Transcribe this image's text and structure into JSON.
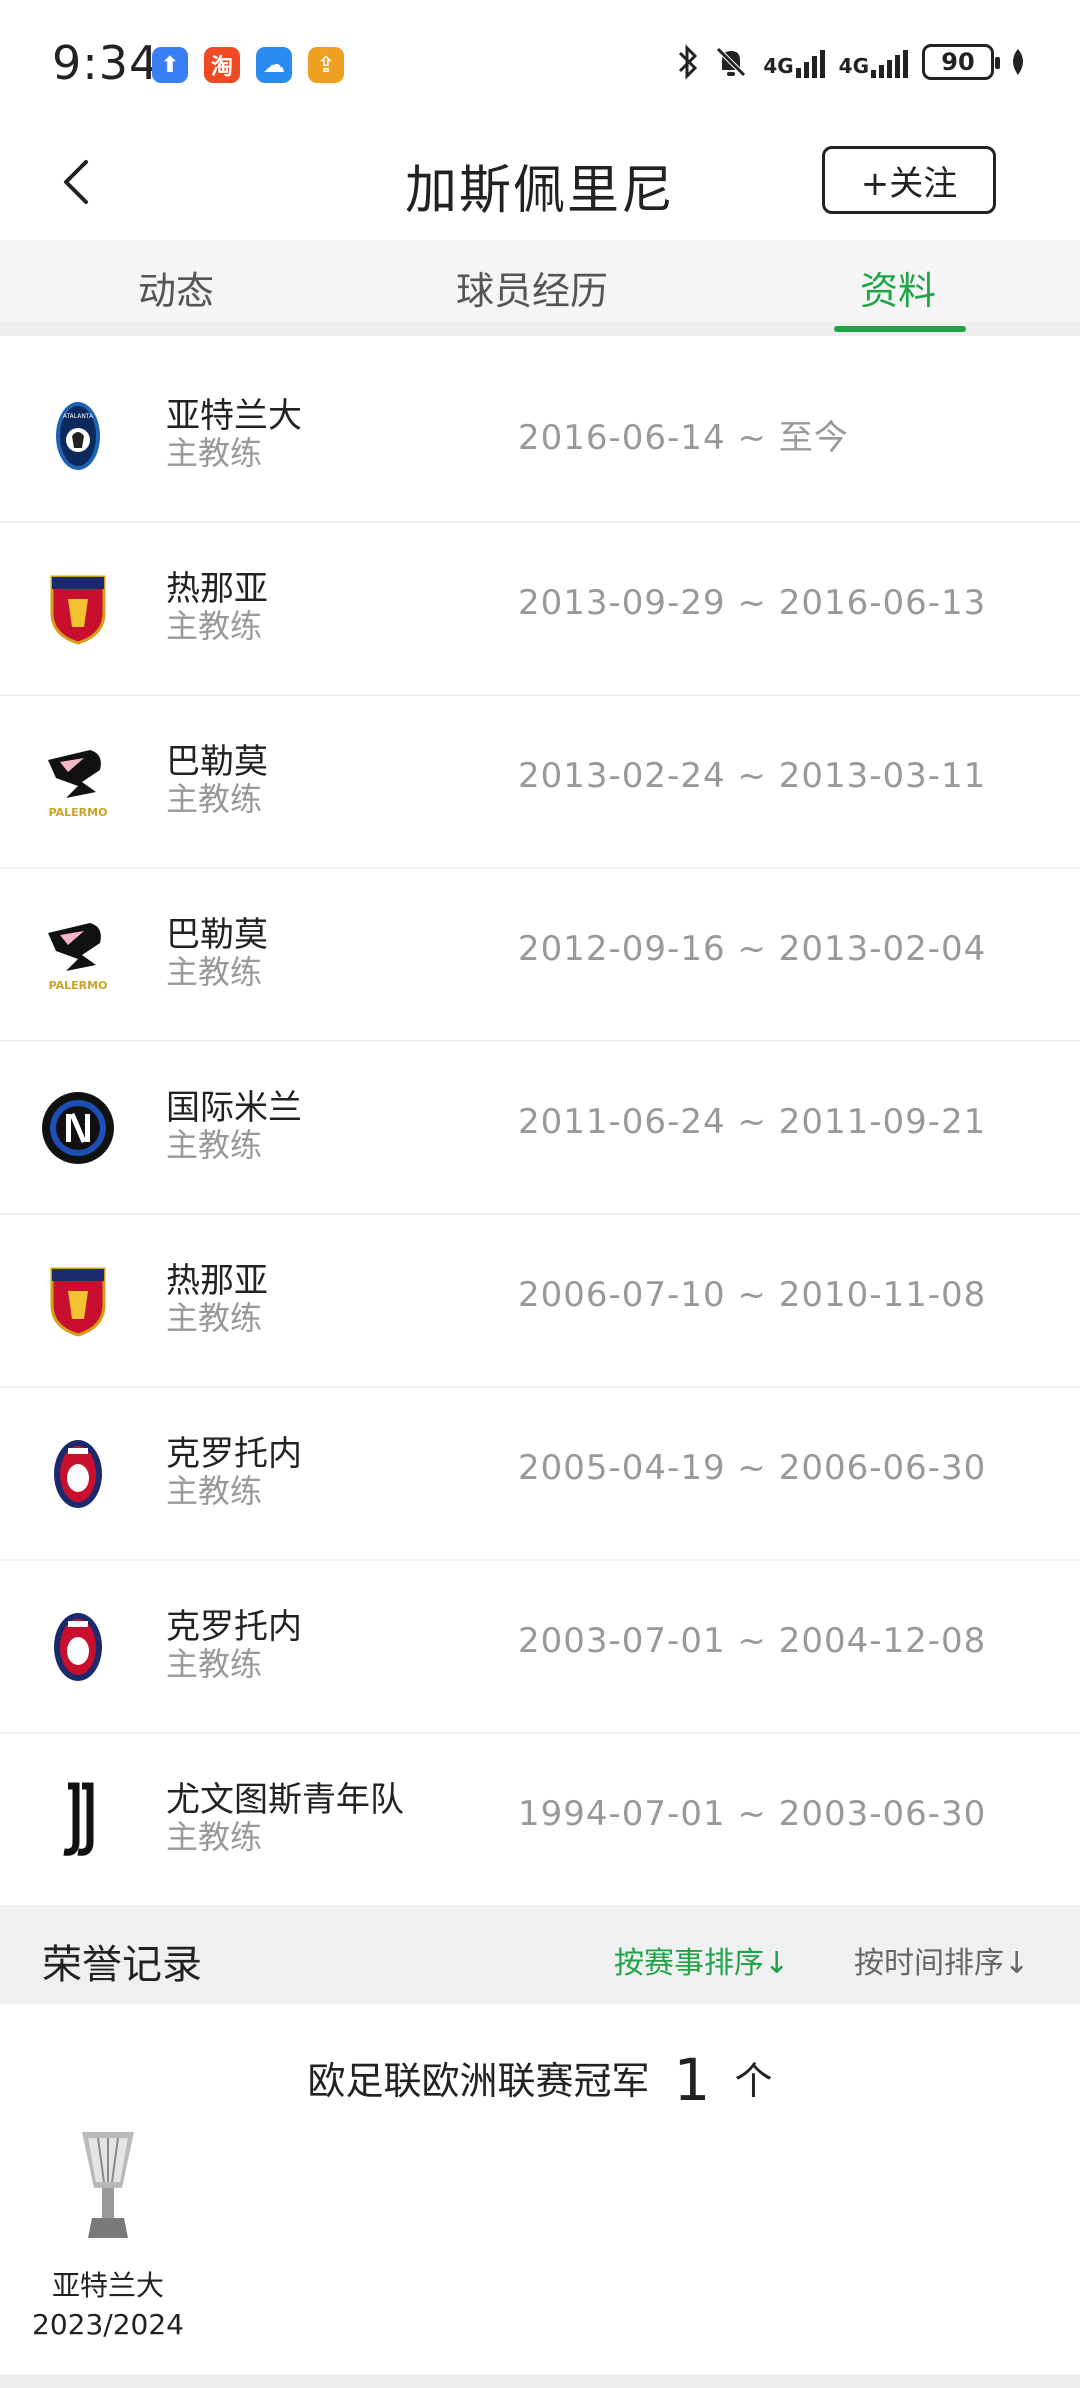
{
  "status_bar": {
    "time": "9:34",
    "apps": [
      {
        "icon": "app-upload-icon",
        "color": "#3a7ef5",
        "glyph": "⬆"
      },
      {
        "icon": "taobao-icon",
        "color": "#f04a24",
        "glyph": "淘"
      },
      {
        "icon": "weather-icon",
        "color": "#2a8cf0",
        "glyph": "☁"
      },
      {
        "icon": "app-tool-icon",
        "color": "#f0a020",
        "glyph": "⇪"
      }
    ],
    "network1": "4G",
    "network2": "4G",
    "battery": "90"
  },
  "header": {
    "title": "加斯佩里尼",
    "follow_label": "+关注"
  },
  "tabs": [
    {
      "label": "动态",
      "active": false
    },
    {
      "label": "球员经历",
      "active": false
    },
    {
      "label": "资料",
      "active": true
    }
  ],
  "history": [
    {
      "club": "亚特兰大",
      "role": "主教练",
      "dates": "2016-06-14 ~ 至今",
      "logo": "atalanta-logo"
    },
    {
      "club": "热那亚",
      "role": "主教练",
      "dates": "2013-09-29 ~ 2016-06-13",
      "logo": "genoa-logo"
    },
    {
      "club": "巴勒莫",
      "role": "主教练",
      "dates": "2013-02-24 ~ 2013-03-11",
      "logo": "palermo-logo"
    },
    {
      "club": "巴勒莫",
      "role": "主教练",
      "dates": "2012-09-16 ~ 2013-02-04",
      "logo": "palermo-logo"
    },
    {
      "club": "国际米兰",
      "role": "主教练",
      "dates": "2011-06-24 ~ 2011-09-21",
      "logo": "inter-logo"
    },
    {
      "club": "热那亚",
      "role": "主教练",
      "dates": "2006-07-10 ~ 2010-11-08",
      "logo": "genoa-logo"
    },
    {
      "club": "克罗托内",
      "role": "主教练",
      "dates": "2005-04-19 ~ 2006-06-30",
      "logo": "crotone-logo"
    },
    {
      "club": "克罗托内",
      "role": "主教练",
      "dates": "2003-07-01 ~ 2004-12-08",
      "logo": "crotone-logo"
    },
    {
      "club": "尤文图斯青年队",
      "role": "主教练",
      "dates": "1994-07-01 ~ 2003-06-30",
      "logo": "juventus-logo"
    }
  ],
  "honors": {
    "title": "荣誉记录",
    "sort_by_competition": "按赛事排序↓",
    "sort_by_time": "按时间排序↓",
    "competition": "欧足联欧洲联赛冠军",
    "count": "1",
    "unit": "个",
    "trophy_club": "亚特兰大",
    "trophy_season": "2023/2024"
  },
  "colors": {
    "accent_green": "#22a347",
    "muted_text": "#999999"
  },
  "palermo_logo_text": "PALERMO",
  "atalanta_logo_text": "ATALANTA"
}
